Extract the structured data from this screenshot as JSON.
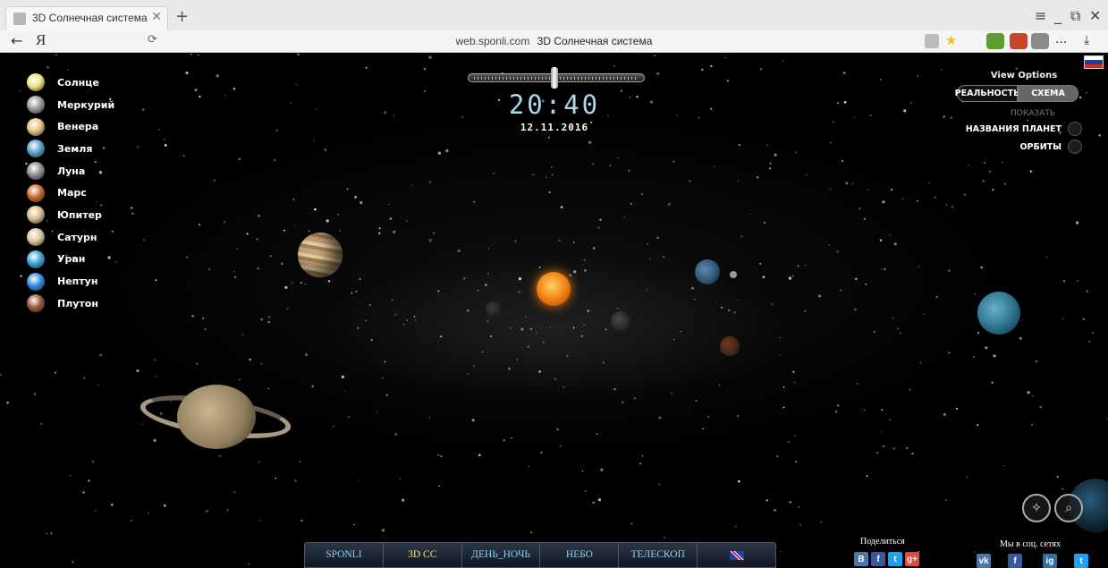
{
  "browser": {
    "tab_title": "3D Солнечная система",
    "tab_close": "✕",
    "new_tab": "+",
    "win_menu": "≡",
    "win_minimize": "_",
    "win_restore": "⧉",
    "win_close": "✕",
    "back": "←",
    "yandex_logo": "Я",
    "reload": "⟳",
    "url_domain": "web.sponli.com",
    "url_title": "3D Солнечная система",
    "bookmark_star": "★",
    "more": "...",
    "download": "⤓",
    "colors": {
      "accent_star": "#f2c200"
    }
  },
  "planet_list": [
    {
      "label": "Солнце",
      "icon": "sun-icon",
      "color": "#f3e27a"
    },
    {
      "label": "Меркурий",
      "icon": "mercury-icon",
      "color": "#9a9a9a"
    },
    {
      "label": "Венера",
      "icon": "venus-icon",
      "color": "#e3c27d"
    },
    {
      "label": "Земля",
      "icon": "earth-icon",
      "color": "#5aa0c8"
    },
    {
      "label": "Луна",
      "icon": "moon-icon",
      "color": "#8d8d8d"
    },
    {
      "label": "Марс",
      "icon": "mars-icon",
      "color": "#c8692e"
    },
    {
      "label": "Юпитер",
      "icon": "jupiter-icon",
      "color": "#d9b98a"
    },
    {
      "label": "Сатурн",
      "icon": "saturn-icon",
      "color": "#d8c49a"
    },
    {
      "label": "Уран",
      "icon": "uranus-icon",
      "color": "#3aa7d8"
    },
    {
      "label": "Нептун",
      "icon": "neptune-icon",
      "color": "#2f8fe0"
    },
    {
      "label": "Плутон",
      "icon": "pluto-icon",
      "color": "#9a5a3a"
    }
  ],
  "time": {
    "clock": "20:40",
    "date": "12.11.2016"
  },
  "view_options": {
    "title": "View Options",
    "reality_label": "РЕАЛЬНОСТЬ",
    "scheme_label": "СХЕМА",
    "active_mode": "scheme",
    "show_label": "ПОКАЗАТЬ",
    "planet_names_label": "НАЗВАНИЯ ПЛАНЕТ",
    "orbits_label": "ОРБИТЫ"
  },
  "bottom_nav": {
    "items": [
      "SPONLI",
      "3D CC",
      "ДЕНЬ_НОЧЬ",
      "НЕБО",
      "ТЕЛЕСКОП"
    ],
    "active_index": 1,
    "language_icon": "uk-flag-icon"
  },
  "share": {
    "label": "Поделиться",
    "icons": [
      "В",
      "f",
      "t",
      "g+"
    ]
  },
  "social": {
    "label": "Мы в соц. сетях",
    "icons": [
      "vk",
      "f",
      "ig",
      "t"
    ]
  },
  "controls": {
    "rotate_icon": "rotate-icon",
    "zoom_icon": "zoom-icon"
  }
}
